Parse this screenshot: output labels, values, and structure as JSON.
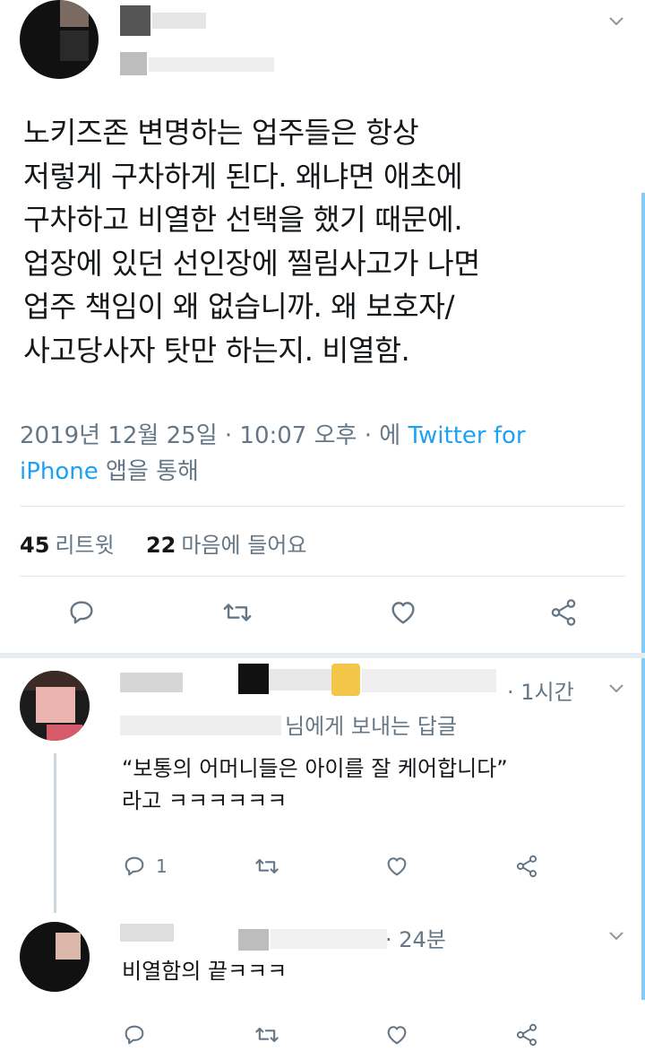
{
  "main_tweet": {
    "lines": [
      "노키즈존 변명하는 업주들은 항상",
      "저렇게 구차하게 된다. 왜냐면 애초에",
      "구차하고 비열한 선택을 했기 때문에.",
      "업장에 있던 선인장에 찔림사고가 나면",
      "업주 책임이 왜 없습니까. 왜 보호자/",
      "사고당사자 탓만 하는지. 비열함."
    ],
    "timestamp": "2019년 12월 25일 · 10:07 오후 · 에",
    "source_link_1": "Twitter for",
    "source_link_2": "iPhone",
    "source_suffix": "앱을 통해",
    "retweet_count": "45",
    "retweet_label": "리트윗",
    "like_count": "22",
    "like_label": "마음에 들어요"
  },
  "replies": [
    {
      "time": "· 1시간",
      "replying_to": "님에게 보내는 답글",
      "text_line_1": "“보통의 어머니들은 아이를 잘 케어합니다”",
      "text_line_2": "라고 ㅋㅋㅋㅋㅋㅋ",
      "reply_count": "1"
    },
    {
      "time": "· 24분",
      "text_line_1": "비열함의 끝ㅋㅋㅋ"
    }
  ],
  "icons": {
    "reply": "reply-icon",
    "retweet": "retweet-icon",
    "like": "heart-icon",
    "share": "share-icon",
    "menu": "chevron-down-icon"
  },
  "colors": {
    "accent": "#1da1f2",
    "secondary_text": "#657786",
    "primary_text": "#14171a"
  }
}
